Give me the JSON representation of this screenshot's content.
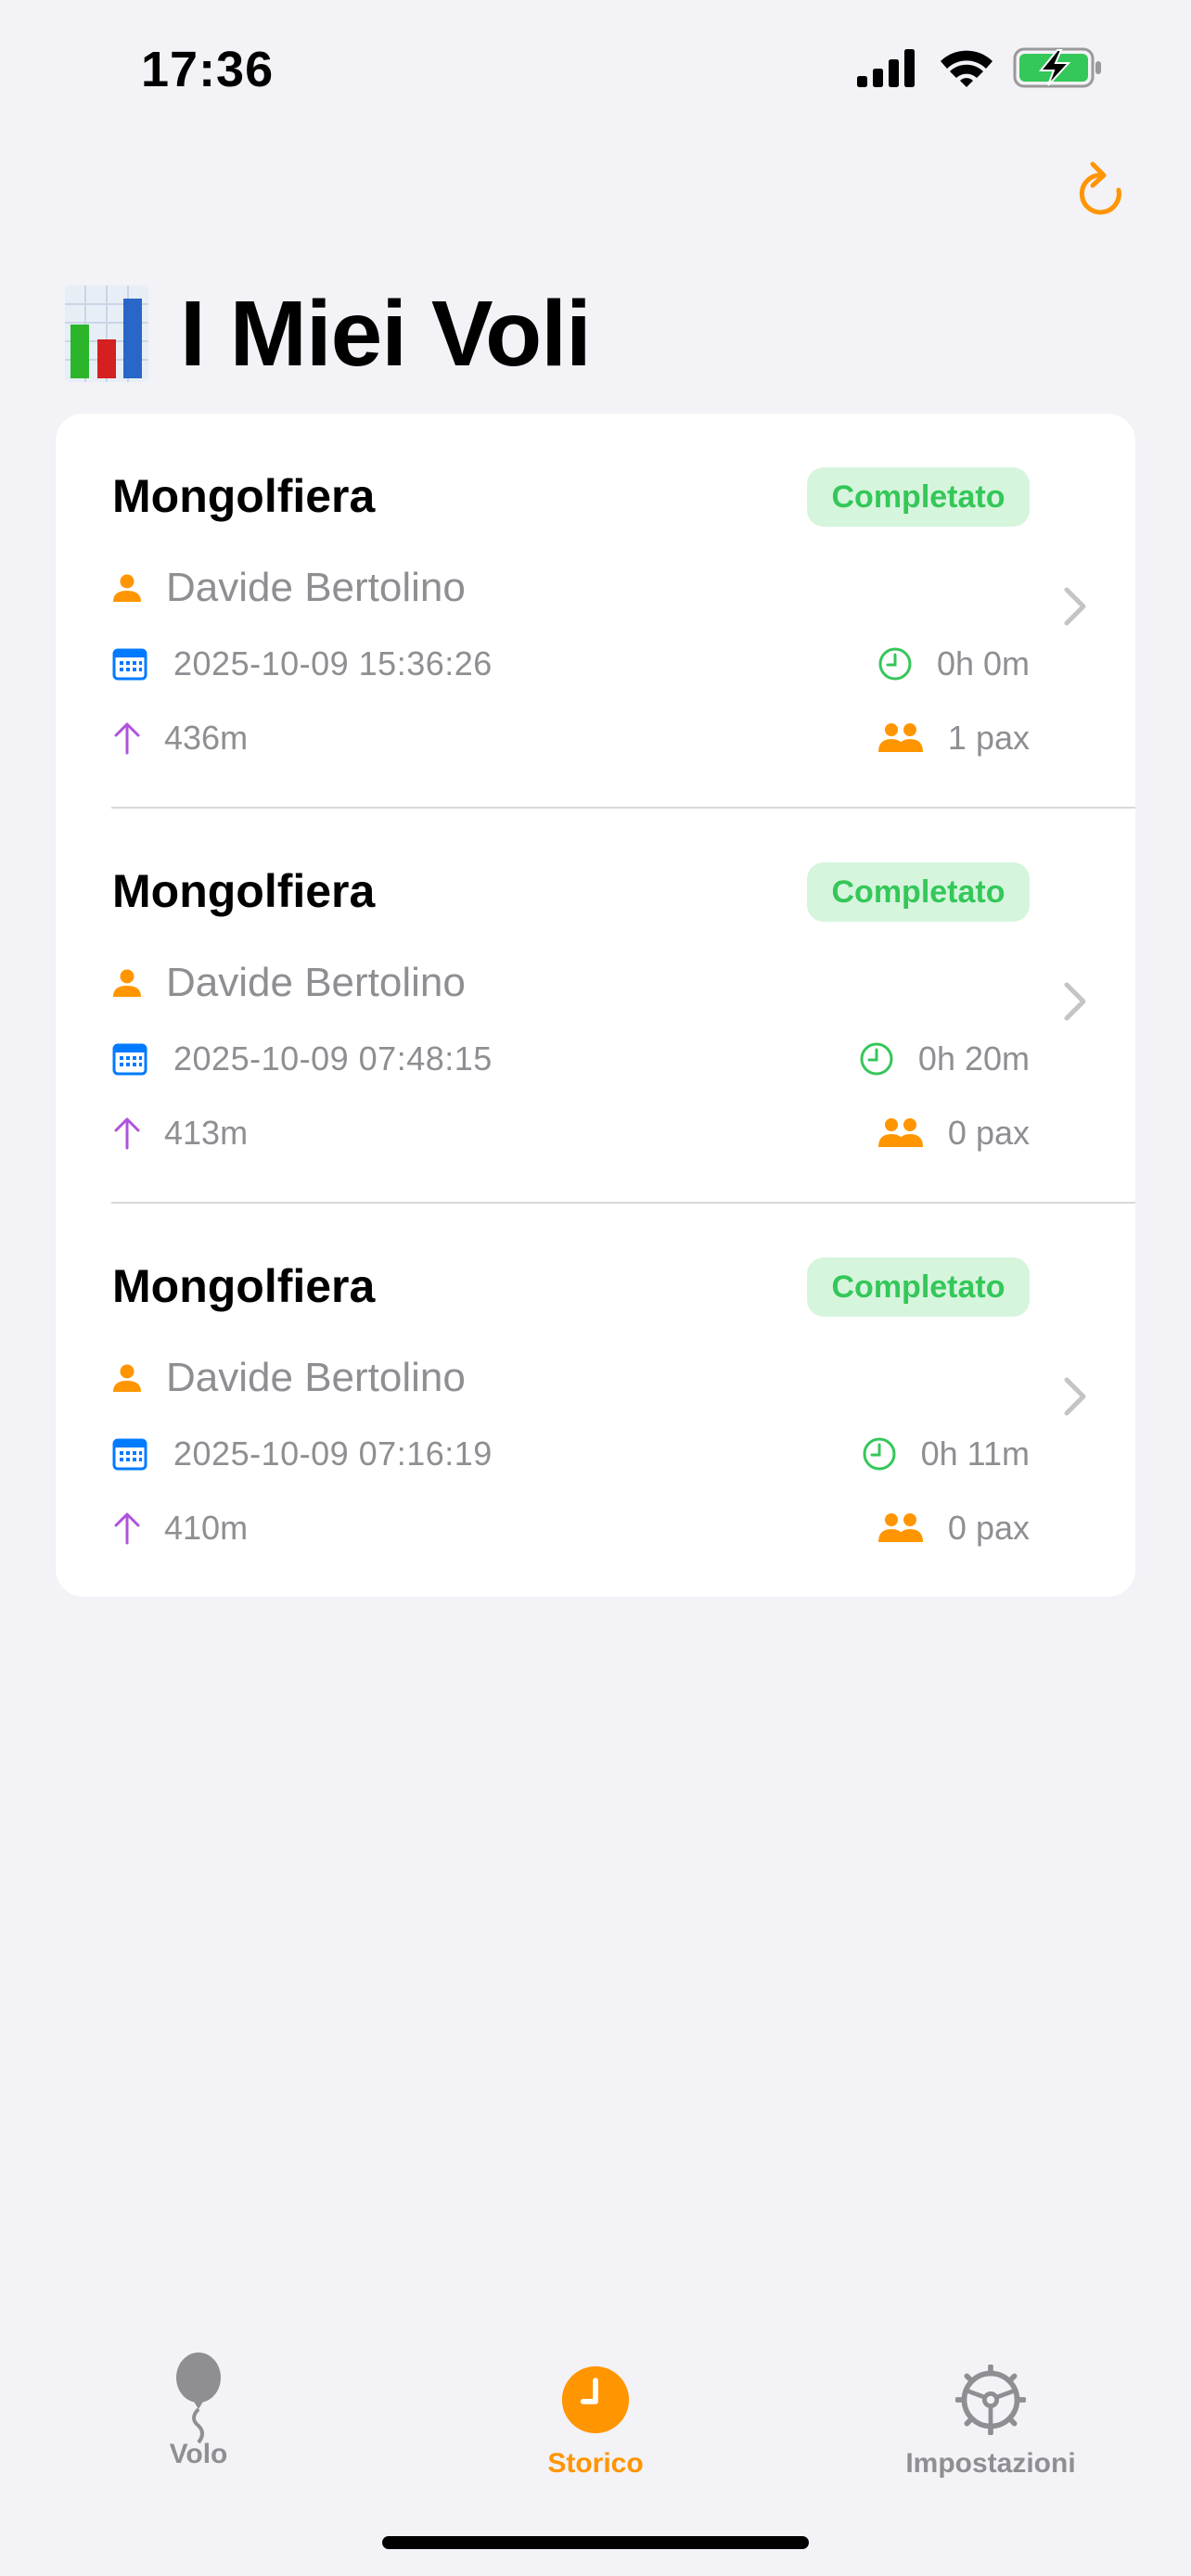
{
  "status_bar": {
    "time": "17:36"
  },
  "header": {
    "title": "I Miei Voli",
    "title_icon": "bar-chart-emoji"
  },
  "flights": [
    {
      "type": "Mongolfiera",
      "status": "Completato",
      "pilot": "Davide Bertolino",
      "datetime": "2025-10-09 15:36:26",
      "duration": "0h 0m",
      "altitude": "436m",
      "pax": "1 pax"
    },
    {
      "type": "Mongolfiera",
      "status": "Completato",
      "pilot": "Davide Bertolino",
      "datetime": "2025-10-09 07:48:15",
      "duration": "0h 20m",
      "altitude": "413m",
      "pax": "0 pax"
    },
    {
      "type": "Mongolfiera",
      "status": "Completato",
      "pilot": "Davide Bertolino",
      "datetime": "2025-10-09 07:16:19",
      "duration": "0h 11m",
      "altitude": "410m",
      "pax": "0 pax"
    }
  ],
  "tab_bar": {
    "tabs": [
      {
        "label": "Volo",
        "icon": "balloon-icon",
        "active": false
      },
      {
        "label": "Storico",
        "icon": "clock-icon",
        "active": true
      },
      {
        "label": "Impostazioni",
        "icon": "steering-wheel-icon",
        "active": false
      }
    ]
  },
  "colors": {
    "accent": "#ff9500",
    "status_green": "#34c759",
    "badge_bg": "#d6f5dd",
    "altitude_purple": "#af52de",
    "calendar_blue": "#007aff",
    "secondary_text": "#8e8e93",
    "background": "#f2f2f7"
  }
}
